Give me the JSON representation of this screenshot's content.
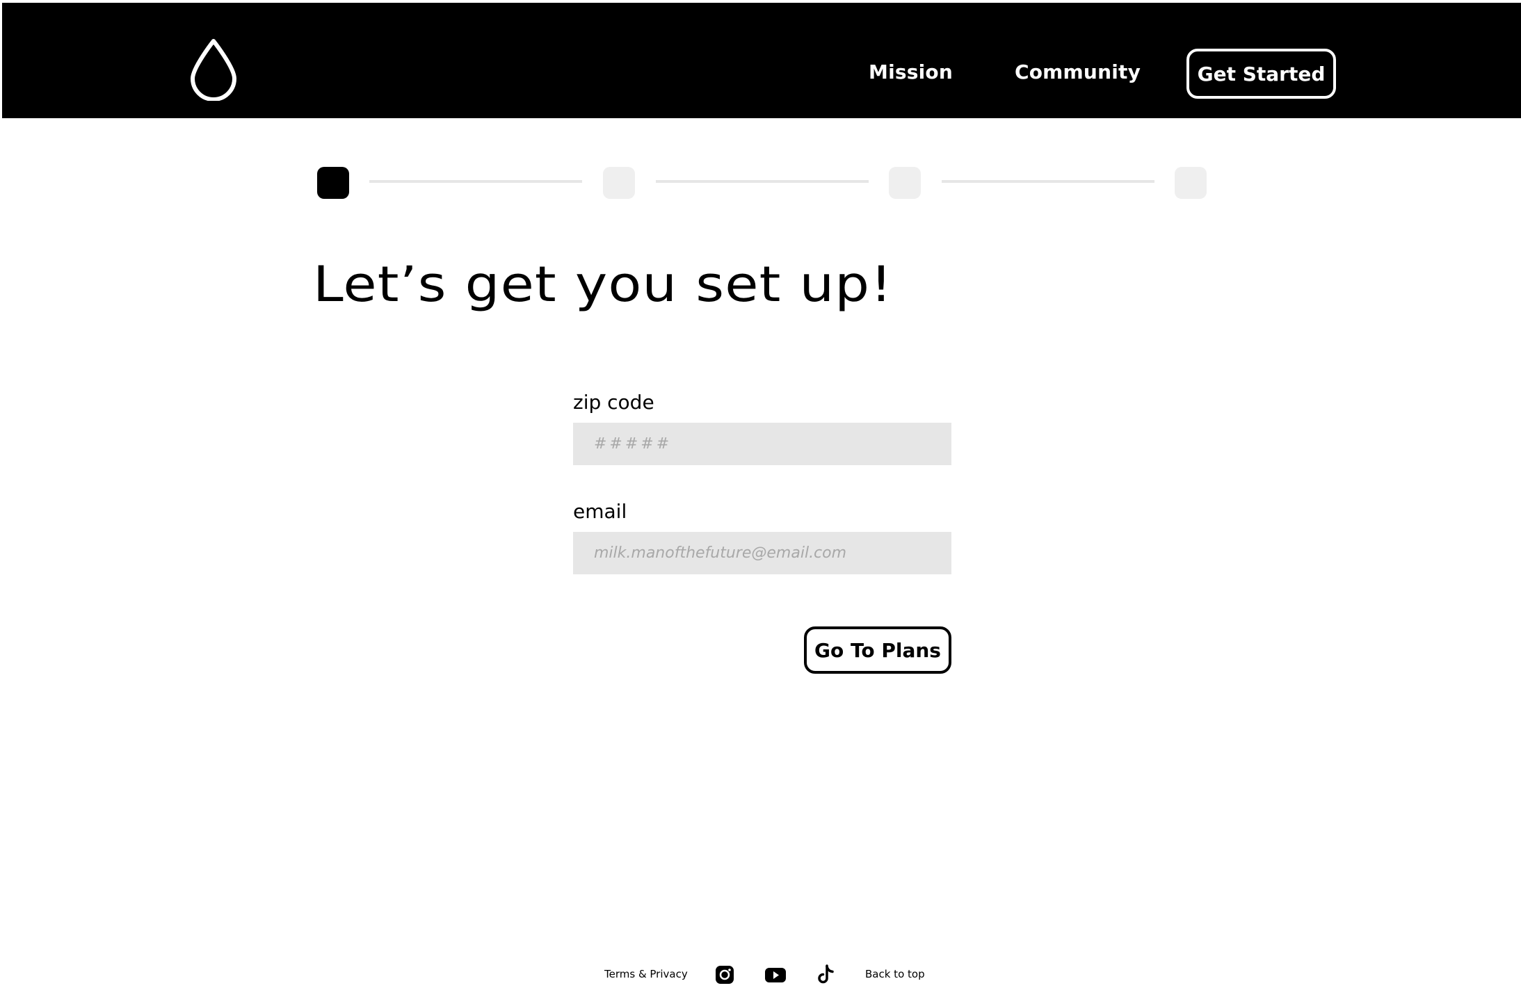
{
  "header": {
    "logo_icon": "water-drop-icon",
    "nav": {
      "mission_label": "Mission",
      "community_label": "Community",
      "get_started_label": "Get Started"
    }
  },
  "stepper": {
    "total_steps": 4,
    "current_step": 1
  },
  "main": {
    "title": "Let’s get you set up!",
    "form": {
      "zip": {
        "label": "zip code",
        "value": "",
        "placeholder": "#####"
      },
      "email": {
        "label": "email",
        "value": "",
        "placeholder": "milk.manofthefuture@email.com"
      },
      "submit_label": "Go To Plans"
    }
  },
  "footer": {
    "terms_label": "Terms & Privacy",
    "social_icons": [
      "instagram-icon",
      "youtube-icon",
      "tiktok-icon"
    ],
    "back_to_top_label": "Back to top"
  },
  "colors": {
    "header_bg": "#000000",
    "input_bg": "#e6e6e6",
    "step_inactive": "#efefef",
    "step_active": "#000000"
  }
}
